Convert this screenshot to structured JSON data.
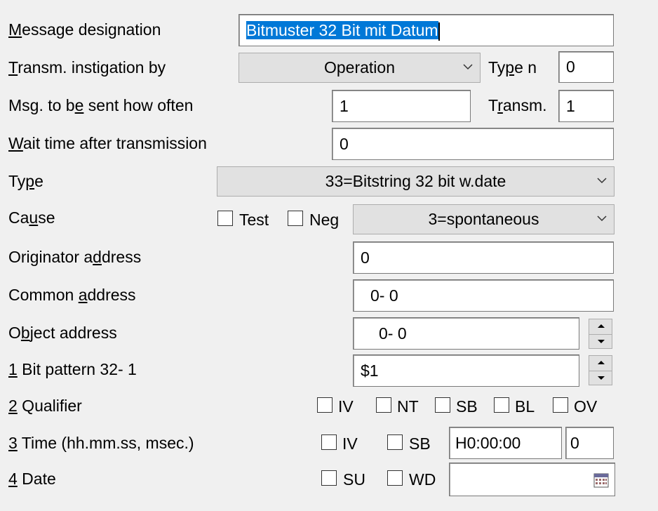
{
  "labels": {
    "message_designation": {
      "pre": "",
      "ul": "M",
      "post": "essage designation"
    },
    "transm_instigation": {
      "pre": "",
      "ul": "T",
      "post": "ransm. instigation by"
    },
    "msg_sent_often": {
      "pre": "Msg. to b",
      "ul": "e",
      "post": " sent how often"
    },
    "wait_time": {
      "pre": "",
      "ul": "W",
      "post": "ait time after transmission"
    },
    "type": {
      "pre": "Ty",
      "ul": "p",
      "post": "e"
    },
    "cause": {
      "pre": "Ca",
      "ul": "u",
      "post": "se"
    },
    "originator": {
      "pre": "Originator a",
      "ul": "d",
      "post": "dress"
    },
    "common": {
      "pre": "Common ",
      "ul": "a",
      "post": "ddress"
    },
    "object": {
      "pre": "O",
      "ul": "b",
      "post": "ject address"
    },
    "bit_pattern": {
      "pre": "",
      "ul": "1",
      "post": " Bit pattern 32- 1"
    },
    "qualifier": {
      "pre": "",
      "ul": "2",
      "post": " Qualifier"
    },
    "time": {
      "pre": "",
      "ul": "3",
      "post": " Time (hh.mm.ss,  msec.)"
    },
    "date": {
      "pre": "",
      "ul": "4",
      "post": " Date"
    },
    "type_n": {
      "pre": "Ty",
      "ul": "p",
      "post": "e n"
    },
    "transm": {
      "pre": "T",
      "ul": "r",
      "post": "ansm."
    }
  },
  "values": {
    "message_designation": "Bitmuster 32 Bit mit Datum",
    "transm_instigation": "Operation",
    "type_n": "0",
    "msg_sent_often": "1",
    "transm": "1",
    "wait_time": "0",
    "type": "33=Bitstring 32 bit w.date",
    "cause": "3=spontaneous",
    "originator": "0",
    "common": "0-  0",
    "object": "0-  0",
    "bit_pattern": "$1",
    "time": "H0:00:00",
    "msec": "0",
    "date": ""
  },
  "checkboxes": {
    "cause": [
      {
        "label": "Test",
        "checked": false
      },
      {
        "label": "Neg",
        "checked": false
      }
    ],
    "qualifier": [
      {
        "label": "IV",
        "checked": false
      },
      {
        "label": "NT",
        "checked": false
      },
      {
        "label": "SB",
        "checked": false
      },
      {
        "label": "BL",
        "checked": false
      },
      {
        "label": "OV",
        "checked": false
      }
    ],
    "time": [
      {
        "label": "IV",
        "checked": false
      },
      {
        "label": "SB",
        "checked": false
      }
    ],
    "date": [
      {
        "label": "SU",
        "checked": false
      },
      {
        "label": "WD",
        "checked": false
      }
    ]
  },
  "icons": {
    "dropdown": "chevron-down-icon",
    "spin_up": "spin-up-icon",
    "spin_down": "spin-down-icon",
    "calendar": "calendar-icon"
  },
  "colors": {
    "selection": "#0078d7",
    "background": "#f0f0f0"
  }
}
